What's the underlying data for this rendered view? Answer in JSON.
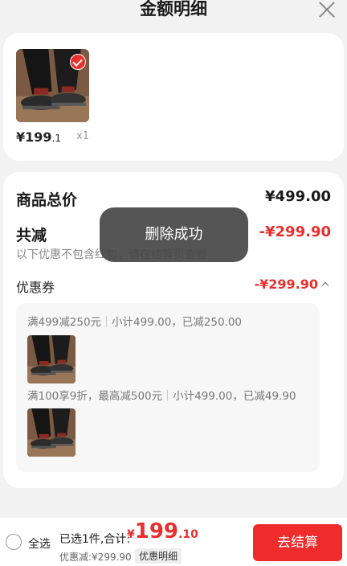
{
  "header": {
    "title": "金额明细"
  },
  "product": {
    "price_main": "¥199",
    "price_dec": ".1",
    "qty": "x1"
  },
  "summary": {
    "total_label": "商品总价",
    "total_value": "¥499.00",
    "discount_label": "共减",
    "discount_value": "-¥299.90",
    "discount_note": "以下优惠不包含红包，请在结算页查看",
    "coupon_label": "优惠券",
    "coupon_value": "-¥299.90"
  },
  "coupons": [
    {
      "name": "满499减250元",
      "detail": "小计499.00，已减250.00"
    },
    {
      "name": "满100享9折，最高减500元",
      "detail": "小计499.00，已减49.90"
    }
  ],
  "toast": "删除成功",
  "footer": {
    "select_all": "全选",
    "selected_text": "已选1件,合计:",
    "total_currency": "¥",
    "total_int": "199",
    "total_dec": ".10",
    "saved_text": "优惠减:¥299.90",
    "detail_button": "优惠明细",
    "checkout_button": "去结算"
  },
  "colors": {
    "accent": "#e8302e",
    "checkout_bg": "#ef2b2b",
    "toast_bg": "#464646"
  }
}
